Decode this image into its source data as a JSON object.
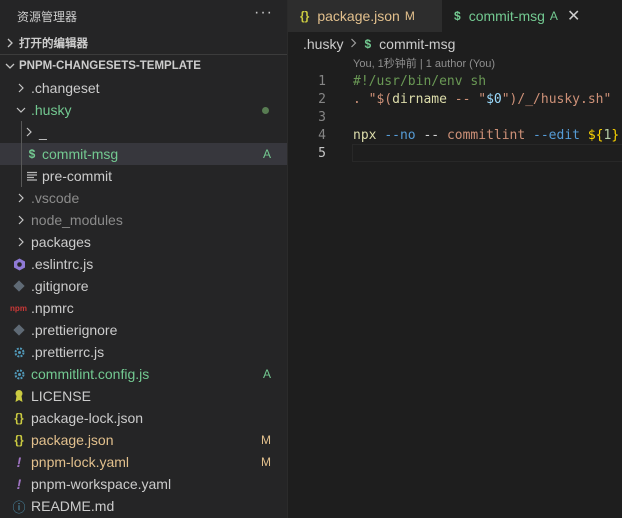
{
  "explorer": {
    "title": "资源管理器",
    "more": "···",
    "open_editors": "打开的编辑器",
    "project": "PNPM-CHANGESETS-TEMPLATE",
    "items": [
      {
        "name": ".changeset",
        "badge": ""
      },
      {
        "name": ".husky",
        "badge": ""
      },
      {
        "name": "_",
        "badge": ""
      },
      {
        "name": "commit-msg",
        "badge": "A",
        "icon": "$"
      },
      {
        "name": "pre-commit",
        "badge": ""
      },
      {
        "name": ".vscode",
        "badge": ""
      },
      {
        "name": "node_modules",
        "badge": ""
      },
      {
        "name": "packages",
        "badge": ""
      },
      {
        "name": ".eslintrc.js",
        "badge": ""
      },
      {
        "name": ".gitignore",
        "badge": ""
      },
      {
        "name": ".npmrc",
        "badge": "",
        "icon": "npm"
      },
      {
        "name": ".prettierignore",
        "badge": ""
      },
      {
        "name": ".prettierrc.js",
        "badge": ""
      },
      {
        "name": "commitlint.config.js",
        "badge": "A"
      },
      {
        "name": "LICENSE",
        "badge": ""
      },
      {
        "name": "package-lock.json",
        "badge": "",
        "icon": "{}"
      },
      {
        "name": "package.json",
        "badge": "M",
        "icon": "{}"
      },
      {
        "name": "pnpm-lock.yaml",
        "badge": "M",
        "icon": "!"
      },
      {
        "name": "pnpm-workspace.yaml",
        "badge": "",
        "icon": "!"
      },
      {
        "name": "README.md",
        "badge": "",
        "icon": "ⓘ"
      }
    ]
  },
  "tabs": [
    {
      "icon": "{}",
      "label": "package.json",
      "badge": "M"
    },
    {
      "icon": "$",
      "label": "commit-msg",
      "badge": "A",
      "close": "✕"
    }
  ],
  "breadcrumb": {
    "folder": ".husky",
    "icon": "$",
    "file": "commit-msg"
  },
  "blame": "You, 1秒钟前 | 1 author (You)",
  "code": {
    "line_numbers": [
      "1",
      "2",
      "3",
      "4",
      "5"
    ],
    "line1": "#!/usr/bin/env sh",
    "line2": {
      "a": ". \"$(",
      "b": "dirname",
      "c": " -- \"",
      "d": "$0",
      "e": "\")/_/husky.sh\""
    },
    "line4": {
      "a": "npx ",
      "b": "--no",
      "c": " -- ",
      "d": "commitlint ",
      "e": "--edit ",
      "f": "${",
      "g": "1",
      "h": "}"
    }
  },
  "colors": {
    "added": "#73c991",
    "modified": "#e2c08d",
    "background": "#1e1e1e",
    "sidebar": "#252526"
  }
}
